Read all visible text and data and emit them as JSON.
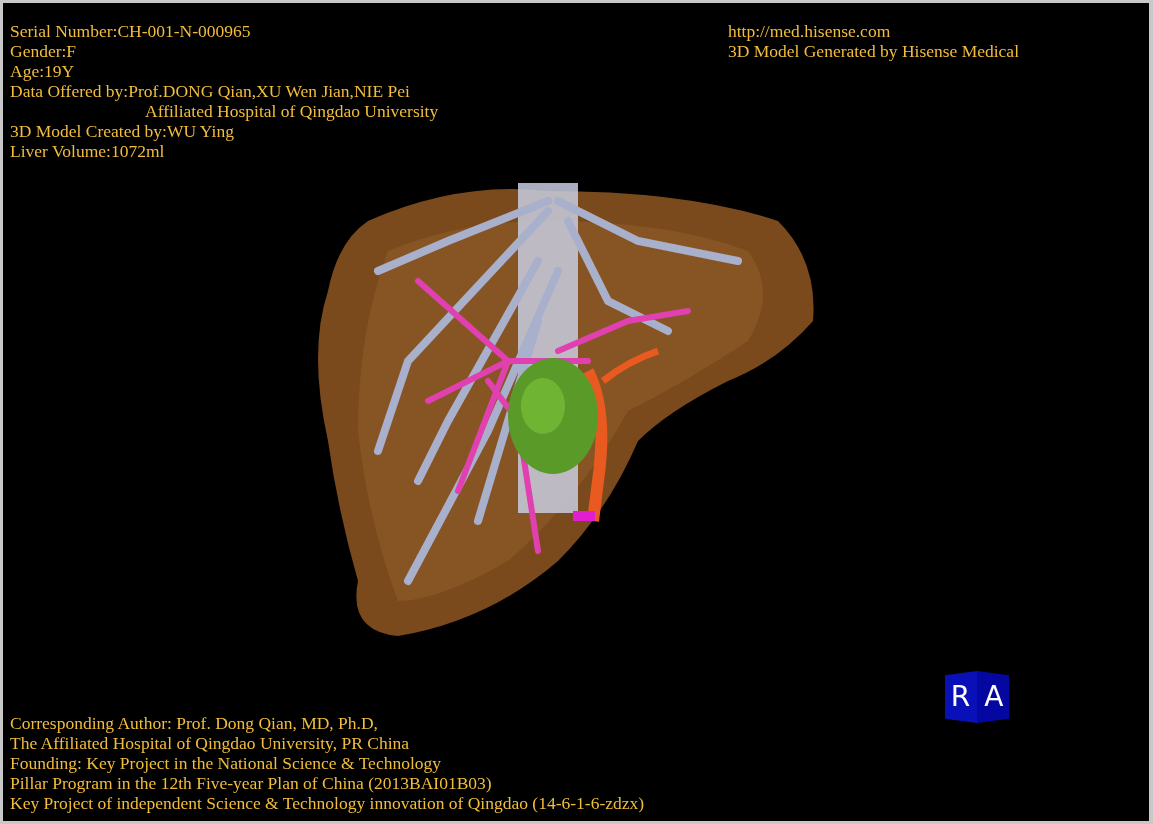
{
  "patient_info": [
    "Serial Number:CH-001-N-000965",
    "Gender:F",
    "Age:19Y",
    "Data Offered by:Prof.DONG Qian,XU Wen Jian,NIE Pei"
  ],
  "patient_info_continued": "Affiliated Hospital of Qingdao University",
  "patient_info_more": [
    "3D Model Created by:WU Ying",
    "Liver Volume:1072ml"
  ],
  "branding": [
    "http://med.hisense.com",
    "3D Model Generated by Hisense Medical"
  ],
  "credits": [
    "Corresponding Author: Prof. Dong Qian, MD, Ph.D,",
    "The Affiliated Hospital of Qingdao University, PR China",
    "Founding: Key Project in the National Science & Technology",
    "Pillar Program in the 12th Five-year Plan of China (2013BAI01B03)",
    "Key Project of independent Science & Technology innovation of Qingdao (14-6-1-6-zdzx)"
  ],
  "orientation_cube": {
    "labels": [
      "R",
      "A"
    ]
  }
}
